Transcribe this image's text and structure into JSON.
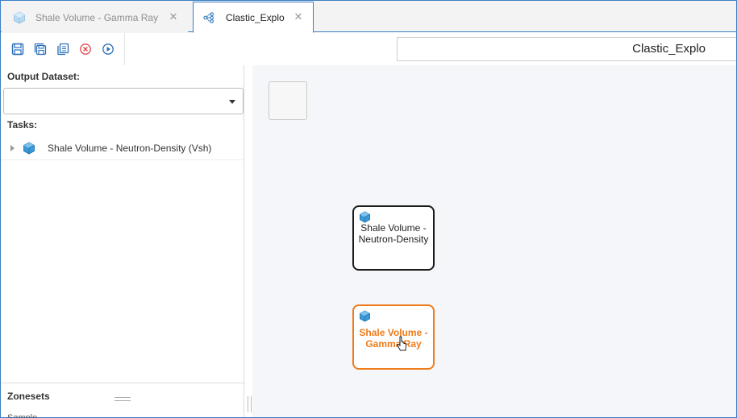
{
  "tabs": [
    {
      "label": "Shale Volume - Gamma Ray",
      "icon": "cube-icon",
      "active": false
    },
    {
      "label": "Clastic_Explo",
      "icon": "workflow-icon",
      "active": true
    }
  ],
  "toolbar": {
    "buttons": [
      "save-icon",
      "save-all-icon",
      "copy-icon",
      "cancel-icon",
      "run-icon"
    ]
  },
  "workflow_title": "Clastic_Explo",
  "left_panel": {
    "output_dataset_label": "Output Dataset:",
    "output_dataset_value": "",
    "tasks_label": "Tasks:",
    "tasks": [
      {
        "label": "Shale Volume - Neutron-Density (Vsh)",
        "icon": "cube-icon"
      }
    ],
    "zonesets_label": "Zonesets",
    "zonesets_partial_item": "Sample"
  },
  "canvas": {
    "nodes": [
      {
        "label": "Shale Volume - Neutron-Density",
        "state": "normal"
      },
      {
        "label": "Shale Volume - Gamma Ray",
        "state": "selected"
      }
    ]
  },
  "colors": {
    "accent": "#3b7fc4",
    "selected_node": "#f07b1a",
    "cube_fill": "#3a9ad9",
    "cancel": "#e04848"
  }
}
